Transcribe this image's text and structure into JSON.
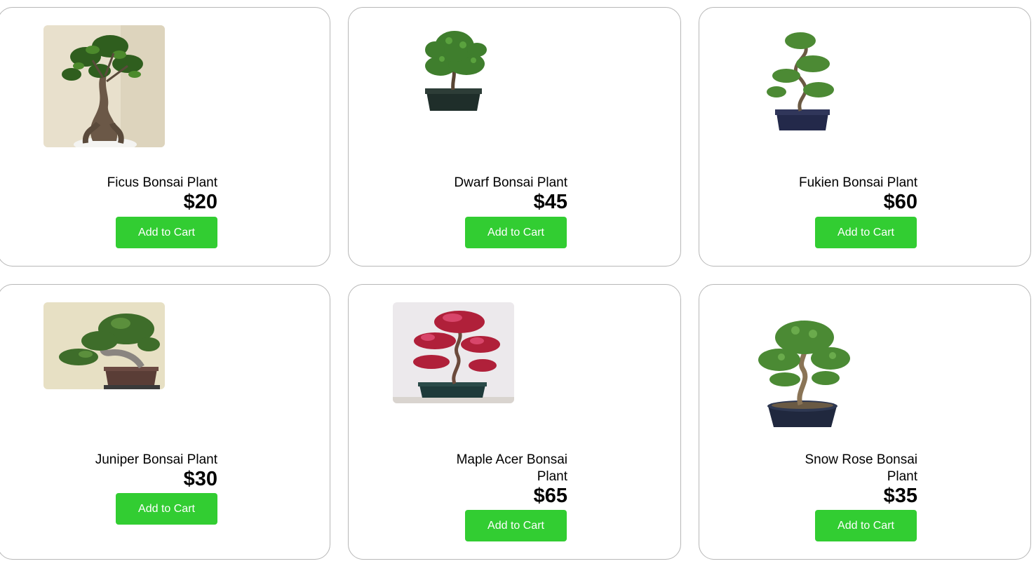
{
  "accent": "#32cd32",
  "products": [
    {
      "name": "Ficus Bonsai Plant",
      "price": "$20",
      "button": "Add to Cart",
      "icon": "ficus-bonsai-image"
    },
    {
      "name": "Dwarf Bonsai Plant",
      "price": "$45",
      "button": "Add to Cart",
      "icon": "dwarf-bonsai-image"
    },
    {
      "name": "Fukien Bonsai Plant",
      "price": "$60",
      "button": "Add to Cart",
      "icon": "fukien-bonsai-image"
    },
    {
      "name": "Juniper Bonsai Plant",
      "price": "$30",
      "button": "Add to Cart",
      "icon": "juniper-bonsai-image"
    },
    {
      "name": "Maple Acer Bonsai Plant",
      "price": "$65",
      "button": "Add to Cart",
      "icon": "maple-acer-bonsai-image"
    },
    {
      "name": "Snow Rose Bonsai Plant",
      "price": "$35",
      "button": "Add to Cart",
      "icon": "snow-rose-bonsai-image"
    }
  ]
}
